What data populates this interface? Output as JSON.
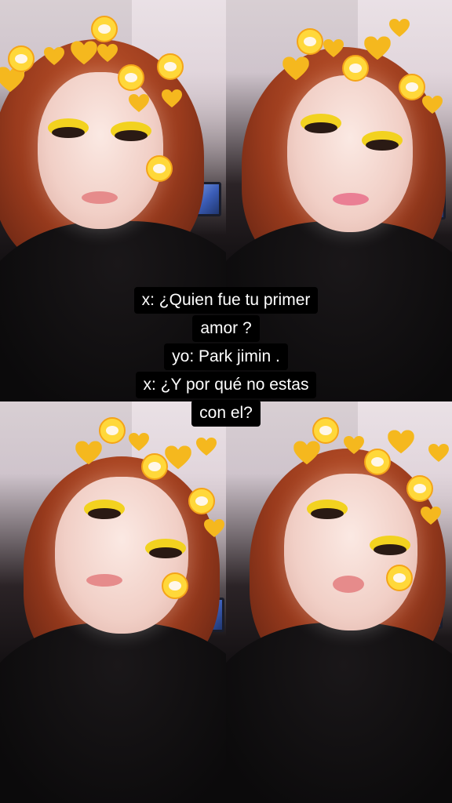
{
  "caption": {
    "lines": [
      "x: ¿Quien fue tu primer",
      "amor ?",
      "yo: Park jimin .",
      "x: ¿Y por qué no estas",
      "con el?"
    ]
  },
  "colors": {
    "caption_bg": "#000000",
    "caption_text": "#ffffff",
    "hair": "#b8492a",
    "eyeshadow": "#f2d21f",
    "sticker_hearts": "#f5b81e"
  },
  "photos": [
    {
      "position": "top-left",
      "expression": "smiling",
      "icon": "heart-crown-filter"
    },
    {
      "position": "top-right",
      "expression": "tongue-out",
      "icon": "heart-crown-filter"
    },
    {
      "position": "bottom-left",
      "expression": "smiling",
      "icon": "heart-crown-filter"
    },
    {
      "position": "bottom-right",
      "expression": "pouting",
      "icon": "heart-crown-filter"
    }
  ]
}
